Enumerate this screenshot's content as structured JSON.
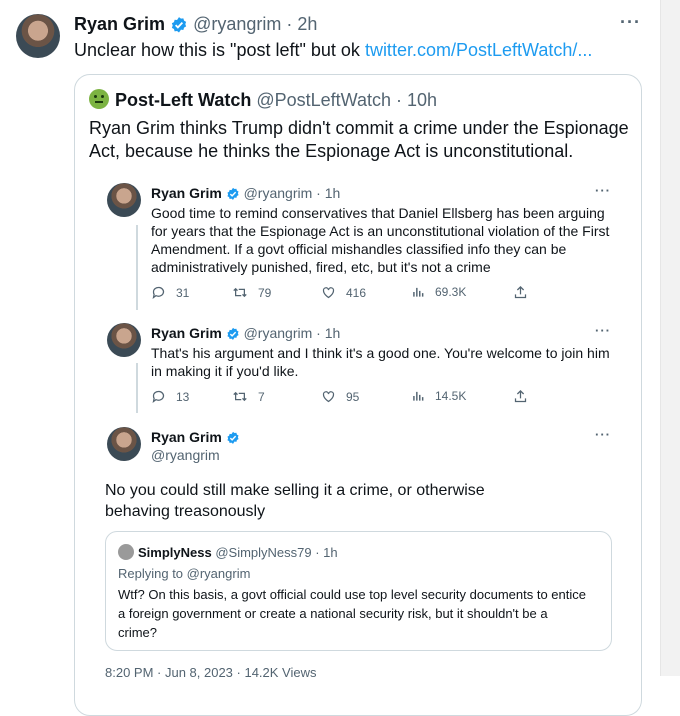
{
  "main": {
    "name": "Ryan Grim",
    "handle": "@ryangrim",
    "time": "· 2h",
    "text": "Unclear how this is \"post left\" but ok",
    "link": "twitter.com/PostLeftWatch/..."
  },
  "quote": {
    "name": "Post-Left Watch",
    "handle": "@PostLeftWatch",
    "time": "· 10h",
    "text": "Ryan Grim thinks Trump didn't commit a crime under the Espionage Act, because he thinks the Espionage Act is unconstitutional."
  },
  "screenshot": {
    "tweets": [
      {
        "name": "Ryan Grim",
        "handle": "@ryangrim",
        "time": "· 1h",
        "text": "Good time to remind conservatives that Daniel Ellsberg has been arguing for years that the Espionage Act is an unconstitutional violation of the First Amendment. If a govt official mishandles classified info they can be administratively punished, fired, etc, but it's not a crime",
        "replies": "31",
        "retweets": "79",
        "likes": "416",
        "views": "69.3K"
      },
      {
        "name": "Ryan Grim",
        "handle": "@ryangrim",
        "time": "· 1h",
        "text": "That's his argument and I think it's a good one. You're welcome to join him in making it if you'd like.",
        "replies": "13",
        "retweets": "7",
        "likes": "95",
        "views": "14.5K"
      }
    ],
    "focus": {
      "name": "Ryan Grim",
      "handle": "@ryangrim",
      "text": "No you could still make selling it a crime, or otherwise behaving treasonously"
    },
    "inner_quote": {
      "name": "SimplyNess",
      "handle": "@SimplyNess79",
      "time": "· 1h",
      "reply": "Replying to @ryangrim",
      "text": "Wtf? On this basis, a govt official could use top level security documents to entice a foreign government or create a national security risk, but it shouldn't be a crime?"
    },
    "footer": "8:20 PM · Jun 8, 2023 · 14.2K Views"
  },
  "icons": {
    "more": "more-icon",
    "verified": "verified-badge-icon",
    "reply": "reply-icon",
    "retweet": "retweet-icon",
    "like": "heart-icon",
    "views": "views-icon",
    "share": "share-icon"
  },
  "colors": {
    "accent": "#1d9bf0",
    "muted": "#536471",
    "border": "#cfd9de"
  }
}
